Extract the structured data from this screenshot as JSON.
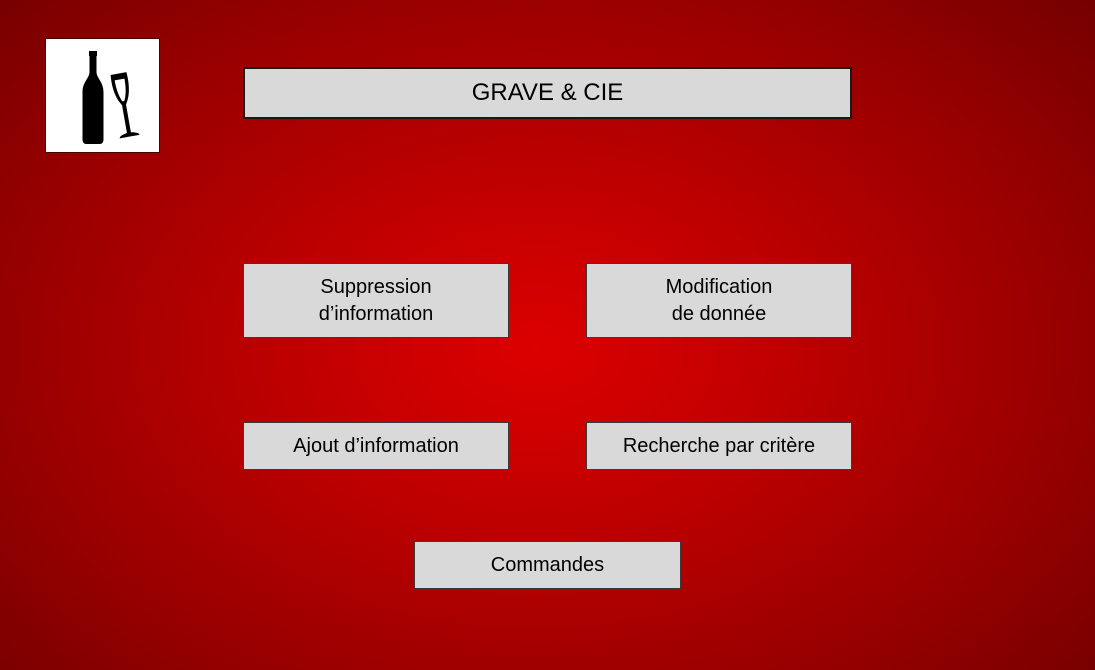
{
  "logo": {
    "icon": "wine-bottle-glass-icon",
    "colors": {
      "box": "#ffffff",
      "icon": "#000000"
    }
  },
  "header": {
    "title": "GRAVE & CIE"
  },
  "menu": {
    "suppression_label": "Suppression\nd’information",
    "modification_label": "Modification\nde donnée",
    "ajout_label": "Ajout d’information",
    "recherche_label": "Recherche par critère",
    "commandes_label": "Commandes"
  },
  "colors": {
    "background_center": "#dc0000",
    "background_edge": "#6a0000",
    "button_fill": "#d9d9d9"
  }
}
